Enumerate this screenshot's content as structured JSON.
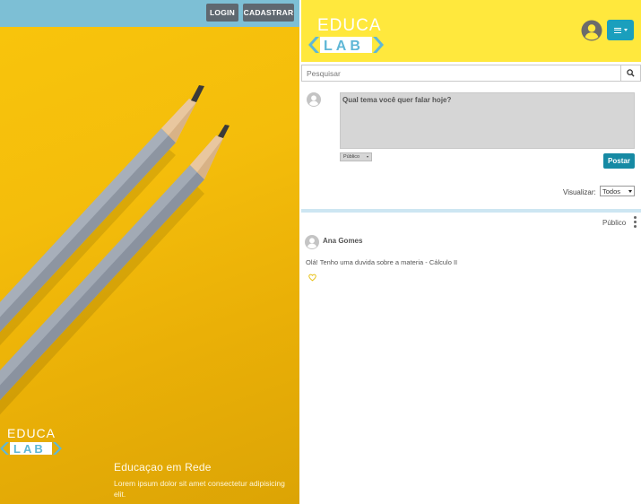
{
  "auth": {
    "login_label": "LOGIN",
    "register_label": "CADASTRAR"
  },
  "hero": {
    "logo_top": "EDUCA",
    "logo_bottom": "LAB",
    "tagline": "Educaçao em Rede",
    "description": "Lorem ipsum dolor sit amet consectetur adipisicing elit."
  },
  "header": {
    "logo_top": "EDUCA",
    "logo_bottom": "LAB"
  },
  "search": {
    "placeholder": "Pesquisar"
  },
  "composer": {
    "placeholder": "Qual tema você quer falar hoje?",
    "privacy_value": "Público",
    "submit_label": "Postar"
  },
  "filter": {
    "label": "Visualizar:",
    "value": "Todos"
  },
  "feed": {
    "posts": [
      {
        "privacy": "Público",
        "author": "Ana Gomes",
        "text": "Olá! Tenho uma duvida sobre a materia - Cálculo II"
      }
    ]
  },
  "colors": {
    "top_bar": "#7dbfd5",
    "hero_yellow": "#f4bd0b",
    "header_yellow": "#ffe83d",
    "accent_teal": "#168aa4",
    "menu_blue": "#1a9fbd",
    "logo_blue": "#5fb7d6"
  },
  "icons": {
    "search": "search-icon",
    "menu": "hamburger-icon",
    "user": "user-avatar-icon",
    "more": "kebab-icon",
    "like": "heart-icon"
  }
}
